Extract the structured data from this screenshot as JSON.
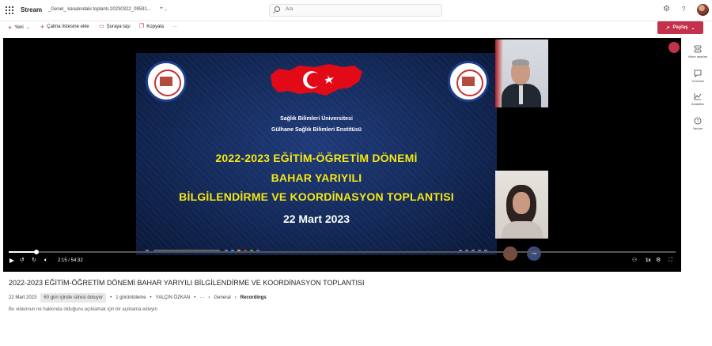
{
  "topbar": {
    "app_name": "Stream",
    "file_name": "_Genel_ kanalındaki toplantı-20230322_09591...",
    "search_placeholder": "Ara"
  },
  "commands": {
    "new": "Yeni",
    "add_playlist": "Çalma listesine ekle",
    "move_to": "Şuraya taşı",
    "copy": "Kopyala",
    "more": "···",
    "share": "Paylaş"
  },
  "slide": {
    "university": "Sağlık Bilimleri Üniversitesi",
    "institute": "Gülhane Sağlık Bilimleri Enstitüsü",
    "line1": "2022-2023 EĞİTİM-ÖĞRETİM DÖNEMİ",
    "line2": "BAHAR YARIYILI",
    "line3": "BİLGİLENDİRME VE KOORDİNASYON TOPLANTISI",
    "date": "22 Mart 2023"
  },
  "player": {
    "time": "2:15 / 54:32",
    "progress": 0.041,
    "speed": "1x",
    "participants_more": "+40"
  },
  "rail": {
    "video_settings": "Video ayarları",
    "comments": "Yorumlar",
    "analytics": "Analytics",
    "help": "Yardım"
  },
  "video": {
    "title": "2022-2023 EĞİTİM-ÖĞRETİM DÖNEMİ BAHAR YARIYILI BİLGİLENDİRME VE KOORDİNASYON TOPLANTISI",
    "date": "22 Mart 2023",
    "expiry": "60 gün içinde süresi doluyor",
    "views": "1 görüntüleme",
    "author": "YALÇIN ÖZKAN",
    "more": "···",
    "crumb1": "General",
    "crumb2": "Recordings",
    "description": "Bu videonun ne hakkında olduğunu açıklamak için bir açıklama ekleyin"
  },
  "colors": {
    "accent": "#c4314b",
    "slide_yellow": "#f5e716",
    "slide_bg": "#142a5a"
  }
}
